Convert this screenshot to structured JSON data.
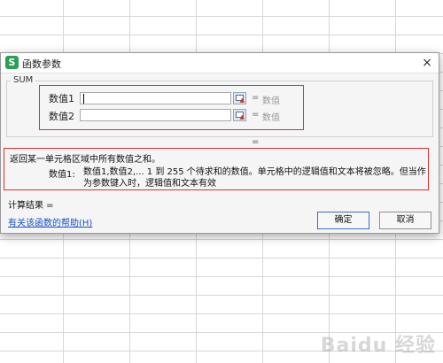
{
  "dialog": {
    "title": "函数参数",
    "app_icon_letter": "S",
    "close_glyph": "×",
    "function_name": "SUM",
    "args": [
      {
        "label": "数值1",
        "value": "",
        "eq": "=",
        "result": "数值"
      },
      {
        "label": "数值2",
        "value": "",
        "eq": "=",
        "result": "数值"
      }
    ],
    "equals": "=",
    "description": "返回某一单元格区域中所有数值之和。",
    "arg_desc_label": "数值1:",
    "arg_desc_text": "数值1,数值2,... 1 到 255 个待求和的数值。单元格中的逻辑值和文本将被忽略。但当作为参数键入时，逻辑值和文本有效",
    "calc_result": "计算结果 =",
    "help_link": "有关该函数的帮助(H)",
    "ok_label": "确定",
    "cancel_label": "取消"
  },
  "watermark": "Baidu 经验",
  "colors": {
    "highlight": "#d9302f",
    "app_icon": "#2e9d55",
    "link": "#1a4fc9"
  }
}
